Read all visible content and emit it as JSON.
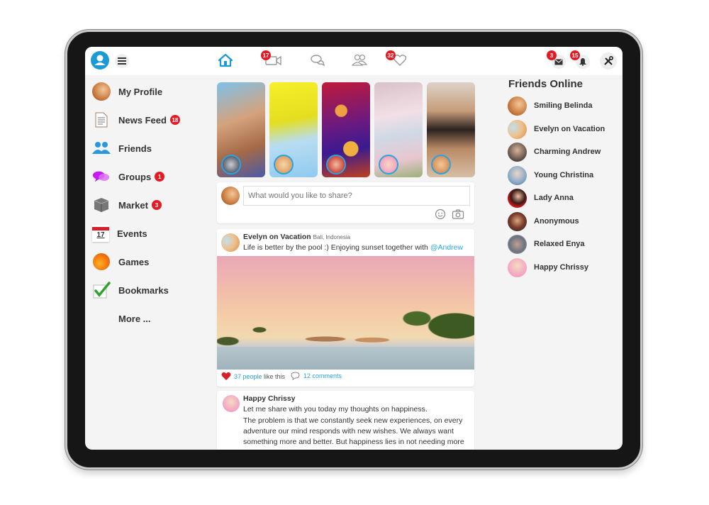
{
  "topbar": {
    "nav": [
      {
        "name": "home",
        "icon": "home-icon",
        "active": true
      },
      {
        "name": "video",
        "icon": "video-camera-icon",
        "badge": "17"
      },
      {
        "name": "chat",
        "icon": "chat-bubbles-icon"
      },
      {
        "name": "people",
        "icon": "people-icon"
      },
      {
        "name": "likes",
        "icon": "heart-icon",
        "badge": "32"
      }
    ],
    "right": [
      {
        "name": "messages",
        "icon": "envelope-icon",
        "badge": "3"
      },
      {
        "name": "notifications",
        "icon": "bell-icon",
        "badge": "15"
      },
      {
        "name": "settings",
        "icon": "tools-icon"
      }
    ],
    "accent": "#1c9ad6"
  },
  "sidebar": {
    "items": [
      {
        "label": "My Profile",
        "icon": "profile-avatar-icon"
      },
      {
        "label": "News Feed",
        "icon": "document-icon",
        "badge": "18"
      },
      {
        "label": "Friends",
        "icon": "friends-icon"
      },
      {
        "label": "Groups",
        "icon": "speech-bubbles-icon",
        "badge": "1"
      },
      {
        "label": "Market",
        "icon": "box-icon",
        "badge": "3"
      },
      {
        "label": "Events",
        "icon": "calendar-icon",
        "date": "17"
      },
      {
        "label": "Games",
        "icon": "games-icon"
      },
      {
        "label": "Bookmarks",
        "icon": "checkmark-icon"
      },
      {
        "label": "More ..."
      }
    ]
  },
  "composer": {
    "placeholder": "What would you like to share?"
  },
  "posts": [
    {
      "author": "Evelyn on Vacation",
      "location": "Bali, Indonesia",
      "text": "Life is better by the pool :) Enjoying sunset together with ",
      "mention": "@Andrew",
      "likes": "37 people",
      "likes_suffix": " like this",
      "comments": "12 comments"
    },
    {
      "author": "Happy Chrissy",
      "line1": "Let me share with you today my thoughts on happiness.",
      "line2": "The problem is that we constantly seek new experiences, on every adventure our mind responds with new wishes. We always want something more and better. But happiness lies in not needing more"
    }
  ],
  "friends_online": {
    "title": "Friends Online",
    "list": [
      "Smiling Belinda",
      "Evelyn on Vacation",
      "Charming Andrew",
      "Young Christina",
      "Lady Anna",
      "Anonymous",
      "Relaxed Enya",
      "Happy Chrissy"
    ]
  }
}
